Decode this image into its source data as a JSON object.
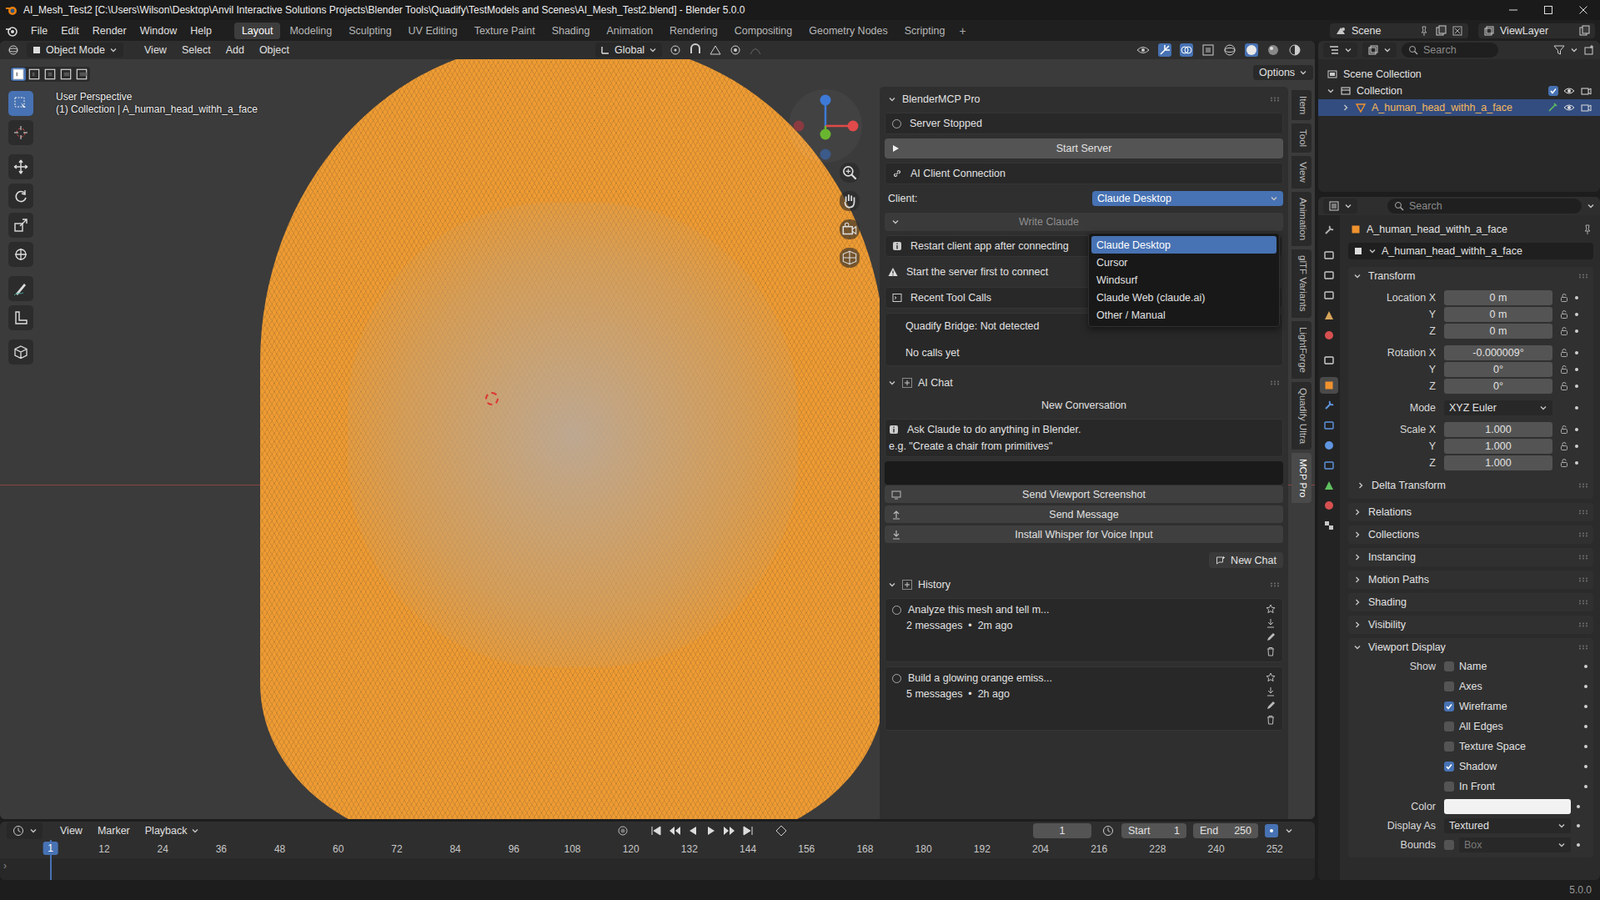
{
  "window": {
    "title": "AI_Mesh_Test2 [C:\\Users\\Wilson\\Desktop\\Anvil Interactive Solutions Projects\\Blender Tools\\Quadify\\TestModels and Scenes\\AI_Mesh_Test2.blend] - Blender 5.0.0"
  },
  "menubar": {
    "menus": [
      "File",
      "Edit",
      "Render",
      "Window",
      "Help"
    ],
    "workspaces": [
      {
        "label": "Layout",
        "selected": true
      },
      {
        "label": "Modeling",
        "selected": false
      },
      {
        "label": "Sculpting",
        "selected": false
      },
      {
        "label": "UV Editing",
        "selected": false
      },
      {
        "label": "Texture Paint",
        "selected": false
      },
      {
        "label": "Shading",
        "selected": false
      },
      {
        "label": "Animation",
        "selected": false
      },
      {
        "label": "Rendering",
        "selected": false
      },
      {
        "label": "Compositing",
        "selected": false
      },
      {
        "label": "Geometry Nodes",
        "selected": false
      },
      {
        "label": "Scripting",
        "selected": false
      }
    ],
    "add_workspace": "+",
    "scene": "Scene",
    "view_layer": "ViewLayer"
  },
  "viewport": {
    "mode": "Object Mode",
    "menus": [
      "View",
      "Select",
      "Add",
      "Object"
    ],
    "orientation": "Global",
    "options": "Options",
    "perspective": "User Perspective",
    "context": "(1) Collection | A_human_head_withh_a_face",
    "tools": [
      {
        "kind": "select",
        "selected": true
      },
      {
        "kind": "cursor",
        "selected": false
      },
      {
        "kind": "move",
        "selected": false
      },
      {
        "kind": "rotate",
        "selected": false
      },
      {
        "kind": "scale",
        "selected": false
      },
      {
        "kind": "transform",
        "selected": false
      },
      {
        "kind": "annotate",
        "selected": false
      },
      {
        "kind": "measure",
        "selected": false
      },
      {
        "kind": "add-cube",
        "selected": false
      }
    ]
  },
  "sidebar": {
    "tabs": [
      {
        "label": "Item",
        "selected": false
      },
      {
        "label": "Tool",
        "selected": false
      },
      {
        "label": "View",
        "selected": false
      },
      {
        "label": "Animation",
        "selected": false
      },
      {
        "label": "glTF Variants",
        "selected": false
      },
      {
        "label": "LightForge",
        "selected": false
      },
      {
        "label": "Quadify Ultra",
        "selected": false
      },
      {
        "label": "MCP Pro",
        "selected": true
      }
    ],
    "mcp": {
      "title": "BlenderMCP Pro",
      "server_status": "Server Stopped",
      "server_running": false,
      "start_button": "Start Server",
      "connection_title": "AI Client Connection",
      "client_label": "Client:",
      "client_value": "Claude Desktop",
      "client_menu_open": true,
      "client_menu": [
        {
          "label": "Claude Desktop",
          "selected": true
        },
        {
          "label": "Cursor",
          "selected": false
        },
        {
          "label": "Windsurf",
          "selected": false
        },
        {
          "label": "Claude Web (claude.ai)",
          "selected": false
        },
        {
          "label": "Other / Manual",
          "selected": false
        }
      ],
      "write_button": "Write Claude",
      "restart_note": "Restart client app after connecting",
      "warning": "Start the server first to connect",
      "tool_calls_title": "Recent Tool Calls",
      "bridge_status": "Quadify Bridge: Not detected",
      "calls_empty": "No calls yet"
    },
    "chat": {
      "title": "AI Chat",
      "conversation": "New Conversation",
      "hint": "Ask Claude to do anything in Blender.",
      "example": "e.g. \"Create a chair from primitives\"",
      "input": "",
      "buttons": [
        {
          "kind": "screenshot",
          "label": "Send Viewport Screenshot"
        },
        {
          "kind": "send",
          "label": "Send Message"
        },
        {
          "kind": "install",
          "label": "Install Whisper for Voice Input"
        }
      ],
      "new_chat": "New Chat"
    },
    "history": {
      "title": "History",
      "items": [
        {
          "title": "Analyze this mesh and tell m...",
          "meta": "2 messages  •  2m ago"
        },
        {
          "title": "Build a glowing orange emiss...",
          "meta": "5 messages  •  2h ago"
        }
      ]
    }
  },
  "outliner": {
    "search": "Search",
    "root": "Scene Collection",
    "items": [
      {
        "label": "Collection",
        "depth": 0,
        "expanded": true,
        "checked": true,
        "visible": true,
        "selected": false
      },
      {
        "label": "A_human_head_withh_a_face",
        "depth": 1,
        "expanded": false,
        "checked": false,
        "visible": true,
        "selected": true
      }
    ]
  },
  "properties": {
    "search": "Search",
    "tabs": [
      {
        "kind": "tool",
        "selected": false
      },
      {
        "kind": "render",
        "selected": false
      },
      {
        "kind": "output",
        "selected": false
      },
      {
        "kind": "view-layer",
        "selected": false
      },
      {
        "kind": "scene",
        "selected": false
      },
      {
        "kind": "world",
        "selected": false
      },
      {
        "kind": "collection",
        "selected": false
      },
      {
        "kind": "object",
        "selected": true
      },
      {
        "kind": "modifiers",
        "selected": false
      },
      {
        "kind": "particles",
        "selected": false
      },
      {
        "kind": "physics",
        "selected": false
      },
      {
        "kind": "constraints",
        "selected": false
      },
      {
        "kind": "data",
        "selected": false
      },
      {
        "kind": "material",
        "selected": false
      },
      {
        "kind": "texture",
        "selected": false
      }
    ],
    "object_name": "A_human_head_withh_a_face",
    "data_name": "A_human_head_withh_a_face",
    "transform": {
      "title": "Transform",
      "expanded": true,
      "groups": [
        [
          {
            "label": "Location X",
            "value": "0 m",
            "kind": "number"
          },
          {
            "label": "Y",
            "value": "0 m",
            "kind": "number"
          },
          {
            "label": "Z",
            "value": "0 m",
            "kind": "number"
          }
        ],
        [
          {
            "label": "Rotation X",
            "value": "-0.000009°",
            "kind": "number"
          },
          {
            "label": "Y",
            "value": "0°",
            "kind": "number"
          },
          {
            "label": "Z",
            "value": "0°",
            "kind": "number"
          }
        ],
        [
          {
            "label": "Mode",
            "value": "XYZ Euler",
            "kind": "dropdown"
          }
        ],
        [
          {
            "label": "Scale X",
            "value": "1.000",
            "kind": "number"
          },
          {
            "label": "Y",
            "value": "1.000",
            "kind": "number"
          },
          {
            "label": "Z",
            "value": "1.000",
            "kind": "number"
          }
        ]
      ],
      "delta": "Delta Transform"
    },
    "panels": [
      {
        "title": "Relations",
        "expanded": false
      },
      {
        "title": "Collections",
        "expanded": false
      },
      {
        "title": "Instancing",
        "expanded": false
      },
      {
        "title": "Motion Paths",
        "expanded": false
      },
      {
        "title": "Shading",
        "expanded": false
      },
      {
        "title": "Visibility",
        "expanded": false
      }
    ],
    "viewport_display": {
      "title": "Viewport Display",
      "expanded": true,
      "show_label": "Show",
      "options": [
        {
          "label": "Name",
          "checked": false
        },
        {
          "label": "Axes",
          "checked": false
        },
        {
          "label": "Wireframe",
          "checked": true
        },
        {
          "label": "All Edges",
          "checked": false
        },
        {
          "label": "Texture Space",
          "checked": false
        },
        {
          "label": "Shadow",
          "checked": true
        },
        {
          "label": "In Front",
          "checked": false
        }
      ],
      "color_label": "Color",
      "swatch": "#f2f2f2",
      "display_as_label": "Display As",
      "display_as": "Textured",
      "bounds_label": "Bounds",
      "bounds_checked": false,
      "bounds_value": "Box",
      "bounds_disabled": true
    }
  },
  "timeline": {
    "menus": [
      "View",
      "Marker",
      "Playback"
    ],
    "current_frame": "1",
    "start_label": "Start",
    "start": "1",
    "end_label": "End",
    "end": "250",
    "ticks": [
      "1",
      "12",
      "24",
      "36",
      "48",
      "60",
      "72",
      "84",
      "96",
      "108",
      "120",
      "132",
      "144",
      "156",
      "168",
      "180",
      "192",
      "204",
      "216",
      "228",
      "240",
      "252"
    ]
  },
  "status_bar": {
    "version": "5.0.0"
  }
}
